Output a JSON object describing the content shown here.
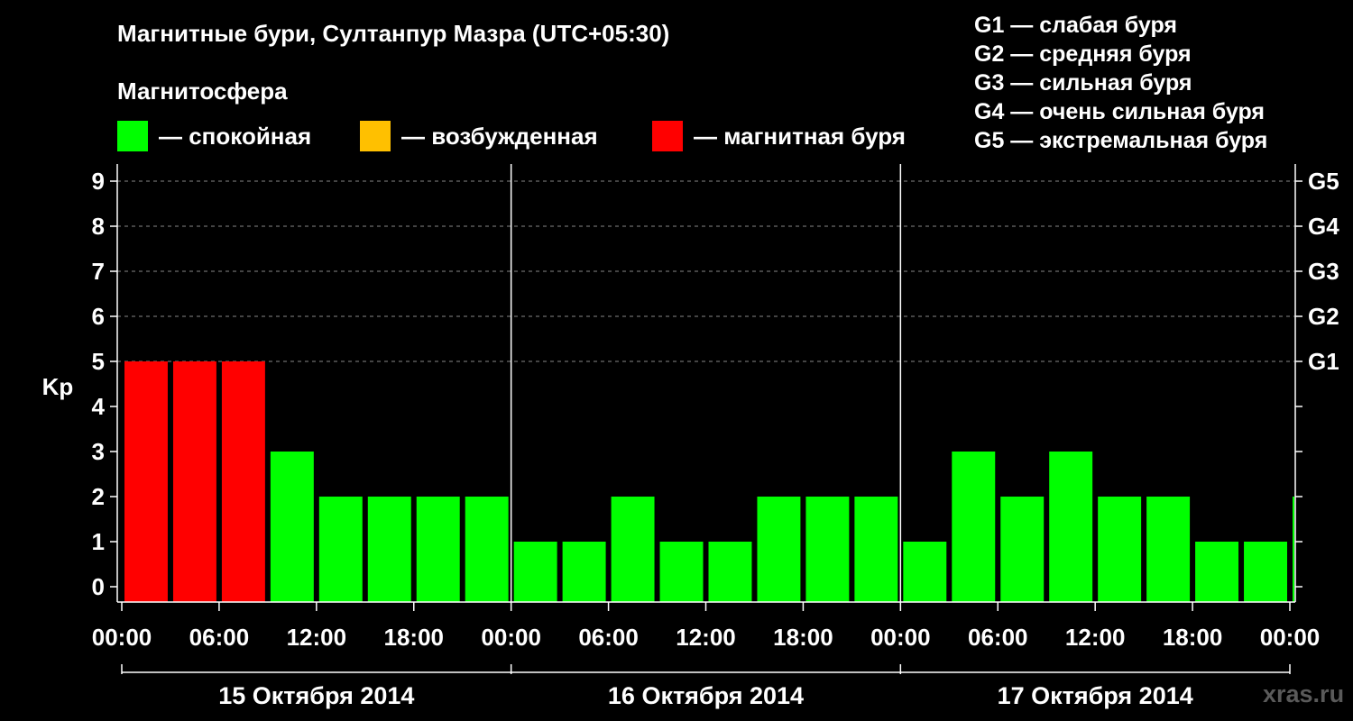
{
  "title": "Магнитные бури, Султанпур Мазра (UTC+05:30)",
  "subtitle": "Магнитосфера",
  "legend": [
    {
      "label": "— спокойная",
      "color": "#00ff00"
    },
    {
      "label": "— возбужденная",
      "color": "#ffc000"
    },
    {
      "label": "— магнитная буря",
      "color": "#ff0000"
    }
  ],
  "g_levels": [
    "G1 — слабая буря",
    "G2 — средняя буря",
    "G3 — сильная буря",
    "G4 — очень сильная буря",
    "G5 — экстремальная буря"
  ],
  "watermark": "xras.ru",
  "chart_data": {
    "type": "bar",
    "ylabel": "Kp",
    "ylim": [
      0,
      9
    ],
    "y_ticks": [
      "0",
      "1",
      "2",
      "3",
      "4",
      "5",
      "6",
      "7",
      "8",
      "9"
    ],
    "right_ticks": [
      {
        "kp": 5,
        "label": "G1"
      },
      {
        "kp": 6,
        "label": "G2"
      },
      {
        "kp": 7,
        "label": "G3"
      },
      {
        "kp": 8,
        "label": "G4"
      },
      {
        "kp": 9,
        "label": "G5"
      }
    ],
    "grid": "dashed horizontal at Kp 5-9",
    "x_ticks": [
      "00:00",
      "06:00",
      "12:00",
      "18:00",
      "00:00",
      "06:00",
      "12:00",
      "18:00",
      "00:00",
      "06:00",
      "12:00",
      "18:00",
      "00:00"
    ],
    "days": [
      "15 Октября 2014",
      "16 Октября 2014",
      "17 Октября 2014"
    ],
    "interval_hours": 3,
    "values": [
      5,
      5,
      5,
      3,
      2,
      2,
      2,
      2,
      1,
      1,
      2,
      1,
      1,
      2,
      2,
      2,
      1,
      3,
      2,
      3,
      2,
      2,
      1,
      1,
      2
    ],
    "colors": {
      "quiet": "#00ff00",
      "active": "#ffc000",
      "storm": "#ff0000"
    }
  }
}
